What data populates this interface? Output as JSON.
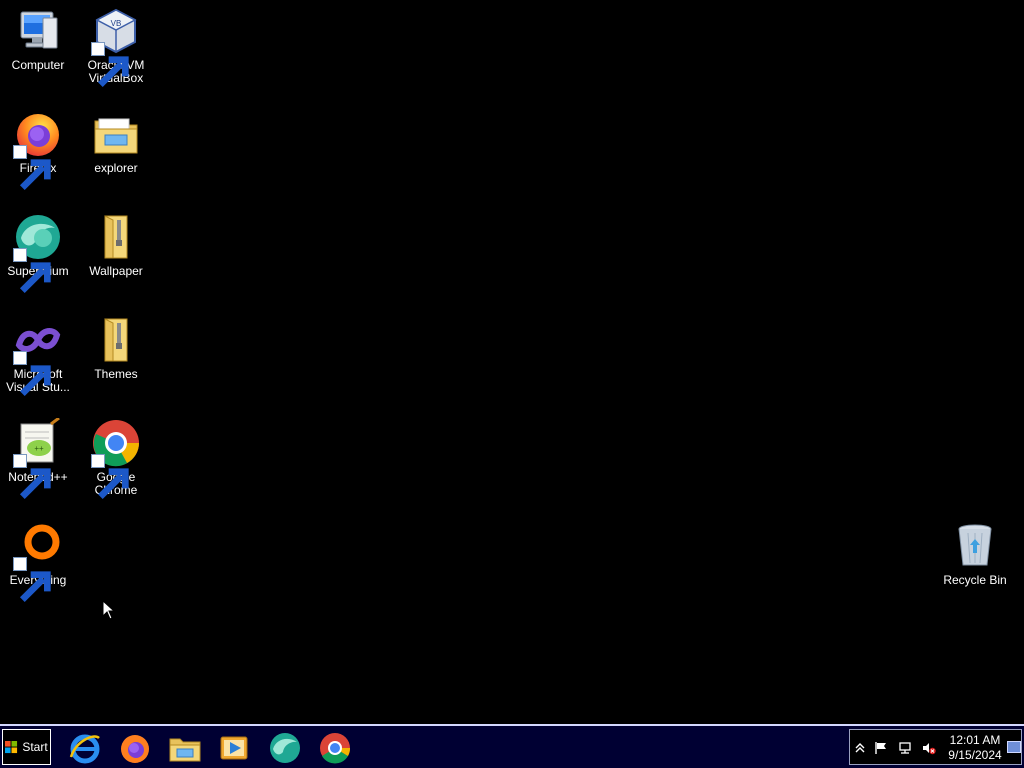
{
  "desktop": {
    "icons": [
      {
        "label": "Computer"
      },
      {
        "label": "Oracle VM\nVirtualBox"
      },
      {
        "label": "Firefox"
      },
      {
        "label": "explorer"
      },
      {
        "label": "Supermium"
      },
      {
        "label": "Wallpaper"
      },
      {
        "label": "Microsoft\nVisual Stu..."
      },
      {
        "label": "Themes"
      },
      {
        "label": "Notepad++"
      },
      {
        "label": "Google\nChrome"
      },
      {
        "label": "Everything"
      },
      {
        "label": "Recycle Bin"
      }
    ]
  },
  "taskbar": {
    "start_label": "Start",
    "pinned": [
      "internet-explorer-icon",
      "firefox-icon",
      "file-explorer-icon",
      "media-player-icon",
      "supermium-icon",
      "chrome-icon"
    ],
    "clock": {
      "time": "12:01 AM",
      "date": "9/15/2024"
    }
  },
  "colors": {
    "desktop_background": "#000000",
    "taskbar_background": "#000033",
    "taskbar_border": "#d4d8ff"
  }
}
